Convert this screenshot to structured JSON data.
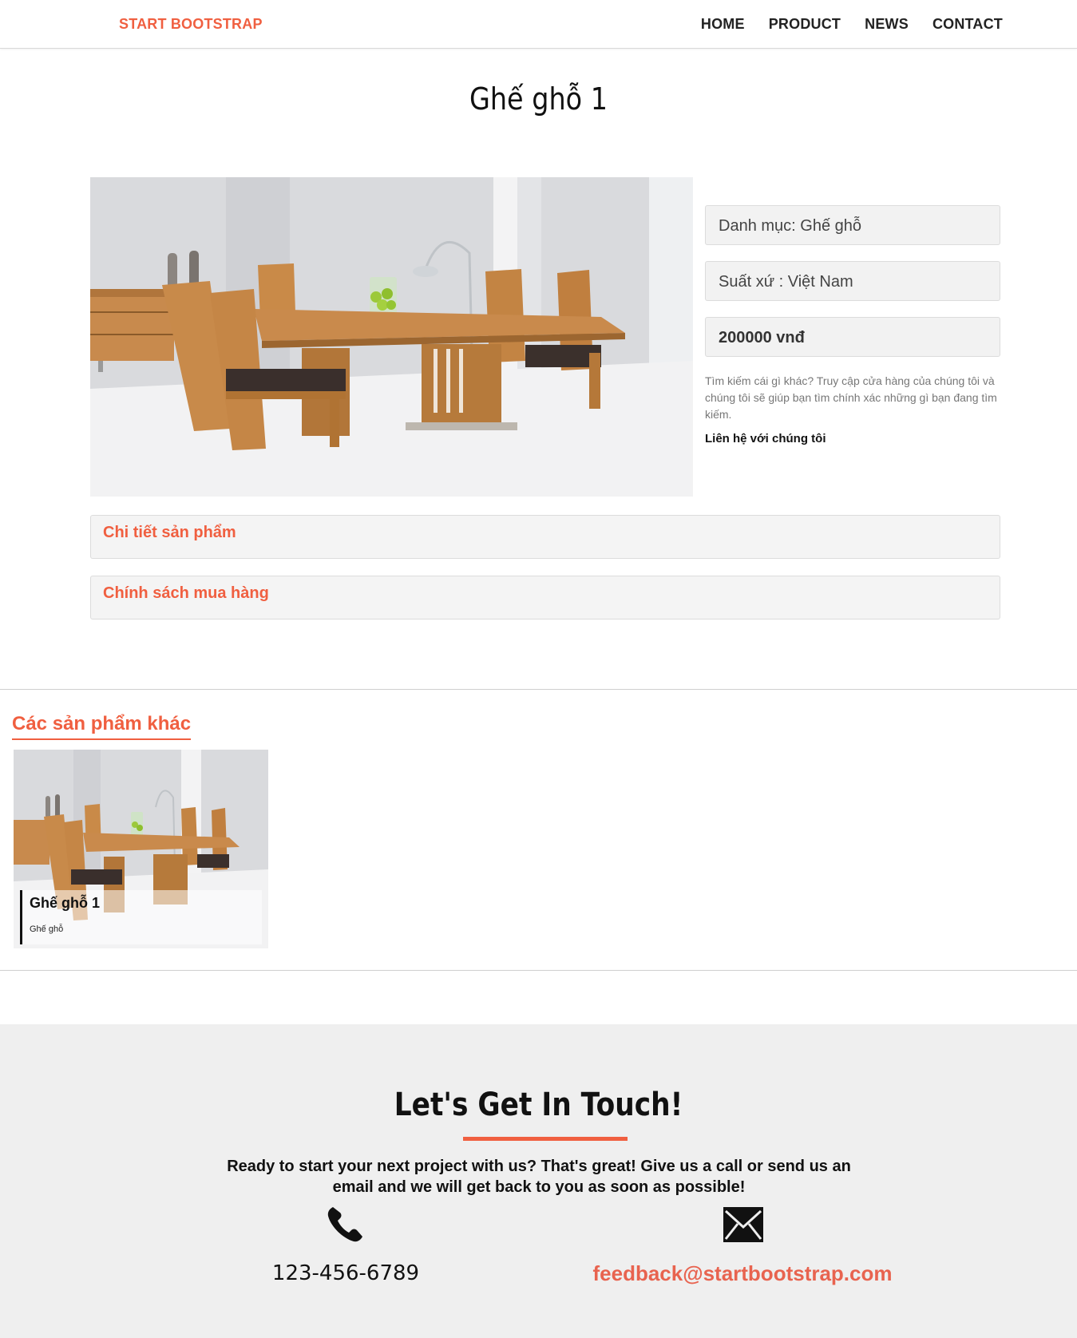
{
  "nav": {
    "brand": "START BOOTSTRAP",
    "links": [
      "HOME",
      "PRODUCT",
      "NEWS",
      "CONTACT"
    ]
  },
  "product": {
    "title": "Ghế ghỗ 1",
    "category": "Danh mục: Ghế ghỗ",
    "origin": "Suất xứ : Việt Nam",
    "price": "200000 vnđ",
    "note": "Tìm kiếm cái gì khác? Truy cập cửa hàng của chúng tôi và chúng tôi sẽ giúp bạn tìm chính xác những gì bạn đang tìm kiếm.",
    "contact_link": "Liên hệ với chúng tôi",
    "image_icon": "dining-table-photo"
  },
  "panels": {
    "details": "Chi tiết sản phẩm",
    "policy": "Chính sách mua hàng"
  },
  "other": {
    "heading": "Các sản phẩm khác",
    "items": [
      {
        "title": "Ghế ghỗ 1",
        "category": "Ghế ghỗ"
      }
    ]
  },
  "footer": {
    "title": "Let's Get In Touch!",
    "text": "Ready to start your next project with us? That's great! Give us a call or send us an email and we will get back to you as soon as possible!",
    "phone": "123-456-6789",
    "email": "feedback@startbootstrap.com",
    "phone_icon": "phone-icon",
    "mail_icon": "envelope-icon"
  },
  "colors": {
    "accent": "#f05f40",
    "panel_bg": "#f4f4f4",
    "footer_bg": "#efefef",
    "email": "#e8634f"
  }
}
